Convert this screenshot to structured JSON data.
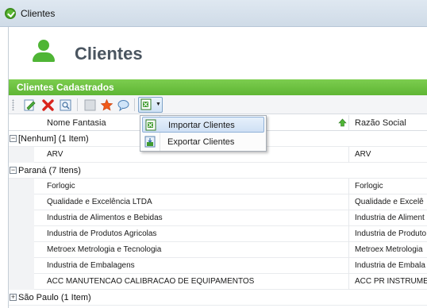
{
  "window": {
    "title": "Clientes"
  },
  "header": {
    "title": "Clientes"
  },
  "panel": {
    "title": "Clientes Cadastrados"
  },
  "toolbar": {
    "buttons": [
      "edit-icon",
      "delete-icon",
      "view-icon",
      "blank-icon",
      "favorite-icon",
      "comment-icon",
      "export-excel-icon"
    ]
  },
  "grid": {
    "columns": {
      "nome_fantasia": "Nome Fantasia",
      "razao_social": "Razão Social"
    },
    "groups": [
      {
        "label": "[Nenhum] (1 Item)",
        "rows": [
          {
            "nome": "ARV",
            "razao": "ARV"
          }
        ]
      },
      {
        "label": "Paraná (7 Itens)",
        "rows": [
          {
            "nome": "Forlogic",
            "razao": "Forlogic"
          },
          {
            "nome": "Qualidade e Excelência LTDA",
            "razao": "Qualidade e Excelê"
          },
          {
            "nome": "Industria de Alimentos e Bebidas",
            "razao": "Industria de Aliment"
          },
          {
            "nome": "Industria de Produtos Agricolas",
            "razao": "Industria de Produto"
          },
          {
            "nome": "Metroex Metrologia e Tecnologia",
            "razao": "Metroex Metrologia"
          },
          {
            "nome": "Industria de Embalagens",
            "razao": "Industria de Embala"
          },
          {
            "nome": "ACC MANUTENCAO CALIBRACAO DE EQUIPAMENTOS",
            "razao": "ACC PR INSTRUME"
          }
        ]
      },
      {
        "label": "São Paulo (1 Item)",
        "rows": []
      }
    ]
  },
  "menu": {
    "items": [
      {
        "label": "Importar Clientes"
      },
      {
        "label": "Exportar Clientes"
      }
    ]
  },
  "colors": {
    "accent_green": "#5fb534",
    "menu_highlight": "#cfe0f4"
  }
}
